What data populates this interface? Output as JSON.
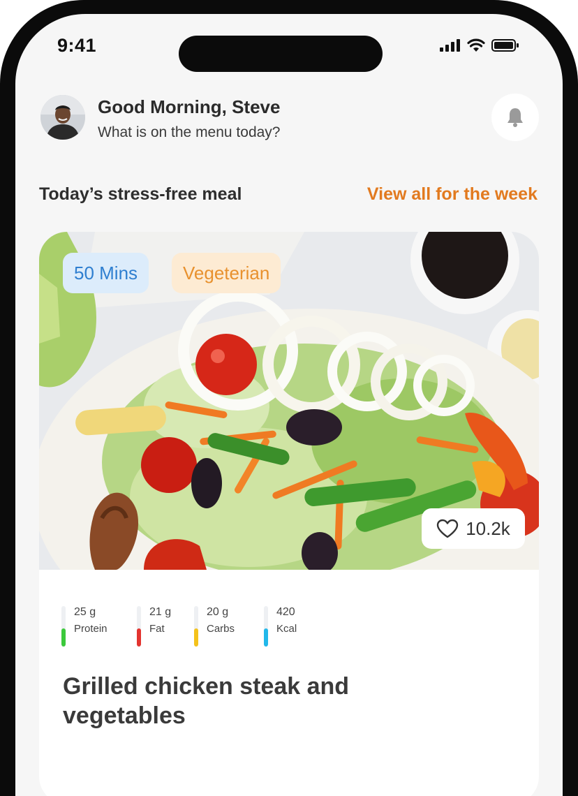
{
  "status_bar": {
    "time": "9:41"
  },
  "header": {
    "greeting": "Good Morning, Steve",
    "subtitle": "What is on the menu today?"
  },
  "section": {
    "title": "Today’s stress-free meal",
    "view_all": "View all for the week"
  },
  "meal": {
    "tags": [
      {
        "label": "50 Mins",
        "color": "#2f7fd0"
      },
      {
        "label": "Vegeterian",
        "color": "#e8912e"
      }
    ],
    "likes": "10.2k",
    "title": "Grilled chicken steak and vegetables",
    "nutrition": [
      {
        "amount": "25 g",
        "label": "Protein",
        "color": "#3cc93c",
        "level": 0.45
      },
      {
        "amount": "21 g",
        "label": "Fat",
        "color": "#e3342f",
        "level": 0.45
      },
      {
        "amount": "20 g",
        "label": "Carbs",
        "color": "#f4c21b",
        "level": 0.45
      },
      {
        "amount": "420",
        "label": "Kcal",
        "color": "#22b8ea",
        "level": 0.45
      }
    ]
  },
  "icons": [
    "signal-icon",
    "wifi-icon",
    "battery-icon",
    "bell-icon",
    "heart-icon"
  ]
}
